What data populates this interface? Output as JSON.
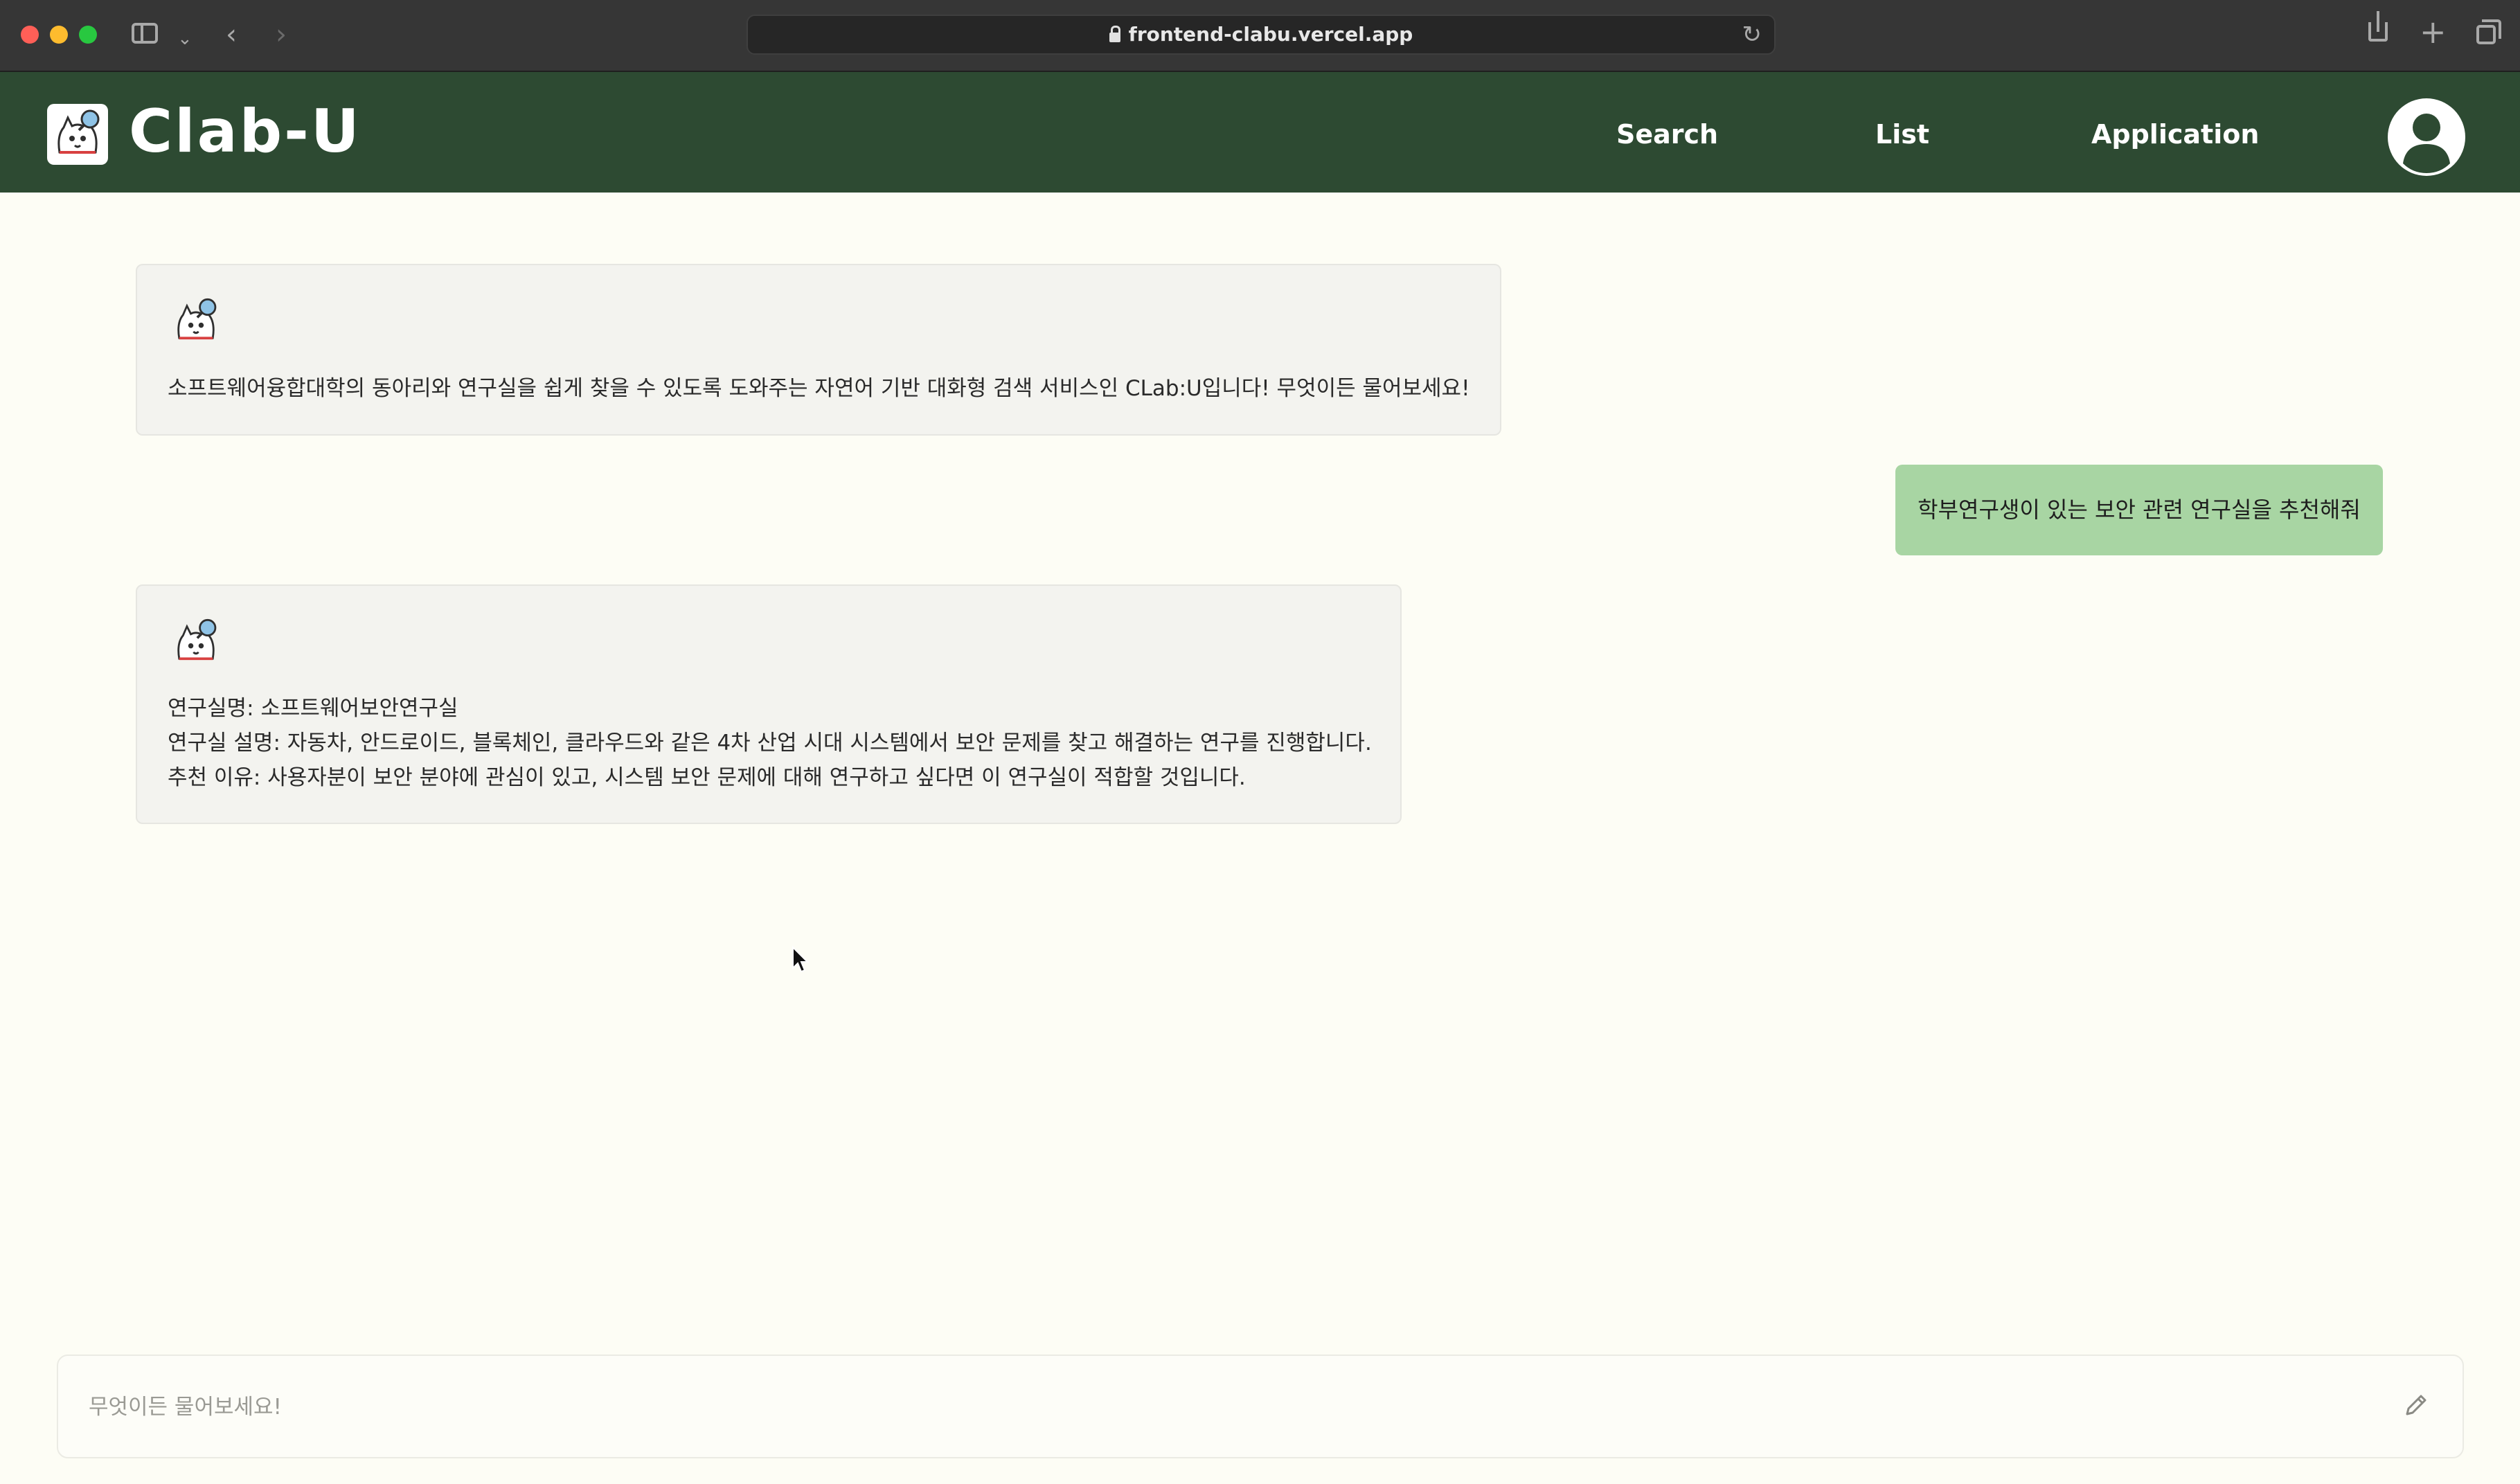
{
  "browser": {
    "url": "frontend-clabu.vercel.app"
  },
  "header": {
    "brand": "Clab-U",
    "nav": {
      "search": "Search",
      "list": "List",
      "application": "Application"
    }
  },
  "chat": {
    "messages": [
      {
        "sender": "bot",
        "lines": [
          "소프트웨어융합대학의 동아리와 연구실을 쉽게 찾을 수 있도록 도와주는 자연어 기반 대화형 검색 서비스인 CLab:U입니다! 무엇이든 물어보세요!"
        ]
      },
      {
        "sender": "user",
        "text": "학부연구생이 있는 보안 관련 연구실을 추천해줘"
      },
      {
        "sender": "bot",
        "lines": [
          "연구실명: 소프트웨어보안연구실",
          "연구실 설명: 자동차, 안드로이드, 블록체인, 클라우드와 같은 4차 산업 시대 시스템에서 보안 문제를 찾고 해결하는 연구를 진행합니다.",
          "추천 이유: 사용자분이 보안 분야에 관심이 있고, 시스템 보안 문제에 대해 연구하고 싶다면 이 연구실이 적합할 것입니다."
        ]
      }
    ]
  },
  "input": {
    "placeholder": "무엇이든 물어보세요!",
    "value": ""
  },
  "icons": {
    "logo": "mascot-magnifier-icon",
    "avatar": "user-avatar-icon",
    "send": "pencil-icon"
  },
  "colors": {
    "header_bg": "#2d4a32",
    "page_bg": "#fdfdf5",
    "user_bubble": "#a8d5a3",
    "bot_bubble": "#f3f3ef"
  }
}
